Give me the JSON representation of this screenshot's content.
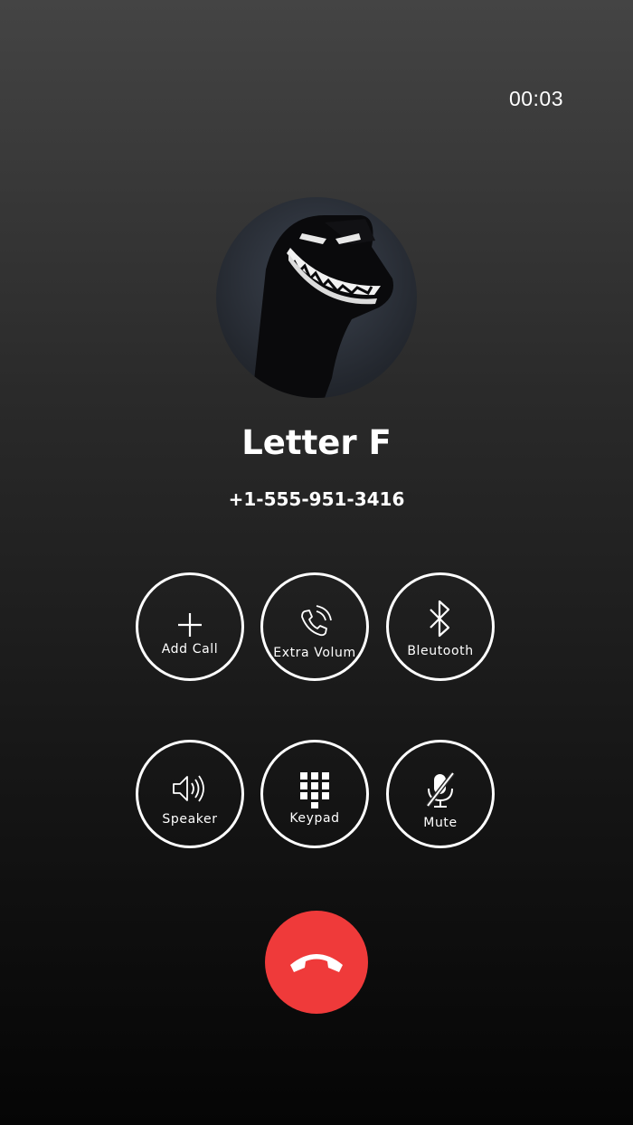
{
  "call": {
    "timer": "00:03",
    "contact_name": "Letter F",
    "contact_number": "+1-555-951-3416"
  },
  "controls": {
    "add_call": "Add Call",
    "extra_volume": "Extra Volum",
    "bluetooth": "Bleutooth",
    "speaker": "Speaker",
    "keypad": "Keypad",
    "mute": "Mute"
  },
  "colors": {
    "end_call": "#ef3a3a",
    "text": "#ffffff"
  },
  "icons": {
    "add_call": "plus-icon",
    "extra_volume": "phone-volume-icon",
    "bluetooth": "bluetooth-icon",
    "speaker": "speaker-icon",
    "keypad": "dialpad-icon",
    "mute": "mic-off-icon",
    "end_call": "phone-hangup-icon"
  }
}
